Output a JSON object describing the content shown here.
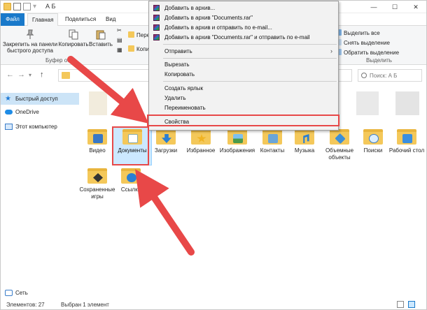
{
  "window": {
    "title": "А Б",
    "controls": {
      "minimize": "—",
      "maximize": "☐",
      "close": "✕"
    }
  },
  "ribbon_tabs": [
    "Файл",
    "Главная",
    "Поделиться",
    "Вид"
  ],
  "ribbon": {
    "pin_label_1": "Закрепить на панели",
    "pin_label_2": "быстрого доступа",
    "copy_label": "Копировать",
    "paste_label": "Вставить",
    "clipboard_group": "Буфер обм",
    "move_label": "Пере",
    "copyto_label": "Копи",
    "select_all": "Выделить все",
    "deselect": "Снять выделение",
    "invert": "Обратить выделение",
    "select_group": "Выделить"
  },
  "address": {
    "search_placeholder": "Поиск: А Б"
  },
  "navpane": {
    "quick_access": "Быстрый доступ",
    "onedrive": "OneDrive",
    "this_pc": "Этот компьютер",
    "network": "Сеть"
  },
  "folders": [
    {
      "label": "Видео",
      "icon": "video-icon"
    },
    {
      "label": "Документы",
      "icon": "documents-icon"
    },
    {
      "label": "Загрузки",
      "icon": "downloads-icon"
    },
    {
      "label": "Избранное",
      "icon": "favorites-icon"
    },
    {
      "label": "Изображения",
      "icon": "pictures-icon"
    },
    {
      "label": "Контакты",
      "icon": "contacts-icon"
    },
    {
      "label": "Музыка",
      "icon": "music-icon"
    },
    {
      "label": "Объемные объекты",
      "icon": "3d-objects-icon"
    },
    {
      "label": "Поиски",
      "icon": "searches-icon"
    },
    {
      "label": "Рабочий стол",
      "icon": "desktop-icon"
    },
    {
      "label": "Сохраненные игры",
      "icon": "saved-games-icon"
    },
    {
      "label": "Ссылки",
      "icon": "links-icon"
    }
  ],
  "context_menu": {
    "add_archive": "Добавить в архив...",
    "add_documents_rar": "Добавить в архив \"Documents.rar\"",
    "add_send_email": "Добавить в архив и отправить по e-mail...",
    "add_rar_send_email": "Добавить в архив \"Documents.rar\" и отправить по e-mail",
    "send_to": "Отправить",
    "cut": "Вырезать",
    "copy": "Копировать",
    "create_shortcut": "Создать ярлык",
    "delete": "Удалить",
    "rename": "Переименовать",
    "properties": "Свойства"
  },
  "status": {
    "count": "Элементов: 27",
    "selected": "Выбран 1 элемент"
  },
  "colors": {
    "accent": "#1979ca",
    "highlight": "#e74848",
    "folder": "#f4c85a",
    "selection": "#cce8ff"
  }
}
